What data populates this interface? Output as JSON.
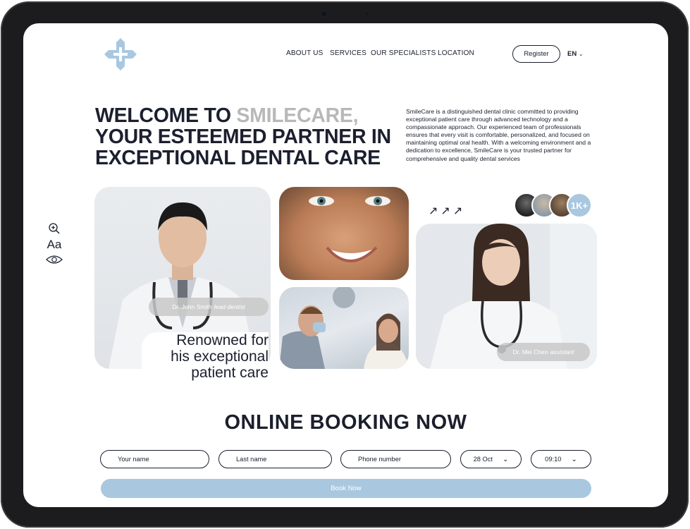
{
  "nav": {
    "items": [
      "ABOUT US",
      "SERVICES",
      "OUR SPECIALISTS",
      "LOCATION"
    ],
    "register_label": "Register",
    "language": "EN"
  },
  "hero": {
    "headline_part1": "WELCOME TO ",
    "headline_accent": "SMILECARE,",
    "headline_line2": "YOUR ESTEEMED PARTNER IN",
    "headline_line3": "EXCEPTIONAL DENTAL CARE",
    "intro": "SmileCare is a distinguished dental clinic committed to providing exceptional patient care through advanced technology and a compassionate approach. Our experienced team of professionals ensures that every visit is comfortable, personalized, and focused on maintaining optimal oral health. With a welcoming environment and a dedication to excellence, SmileCare is your trusted partner for comprehensive and quality dental services"
  },
  "accessibility": {
    "font_label": "Aa"
  },
  "gallery": {
    "doctor1_name": "Dr. John Smith",
    "doctor1_role": "lead dentist",
    "renowned_line1": "Renowned for",
    "renowned_line2": "his exceptional",
    "renowned_line3": "patient care",
    "doctor2_name": "Dr. Mei Chen",
    "doctor2_role": "assistant",
    "arrows": "↗↗↗",
    "patients_count": "1K+"
  },
  "booking": {
    "title": "ONLINE BOOKING NOW",
    "first_name_placeholder": "Your name",
    "last_name_placeholder": "Last name",
    "phone_placeholder": "Phone number",
    "date_value": "28 Oct",
    "time_value": "09:10",
    "submit_label": "Book Now"
  },
  "colors": {
    "text": "#1b1f2e",
    "accent_light_blue": "#a9c8e0",
    "headline_accent_grey": "#b8b8b8"
  }
}
